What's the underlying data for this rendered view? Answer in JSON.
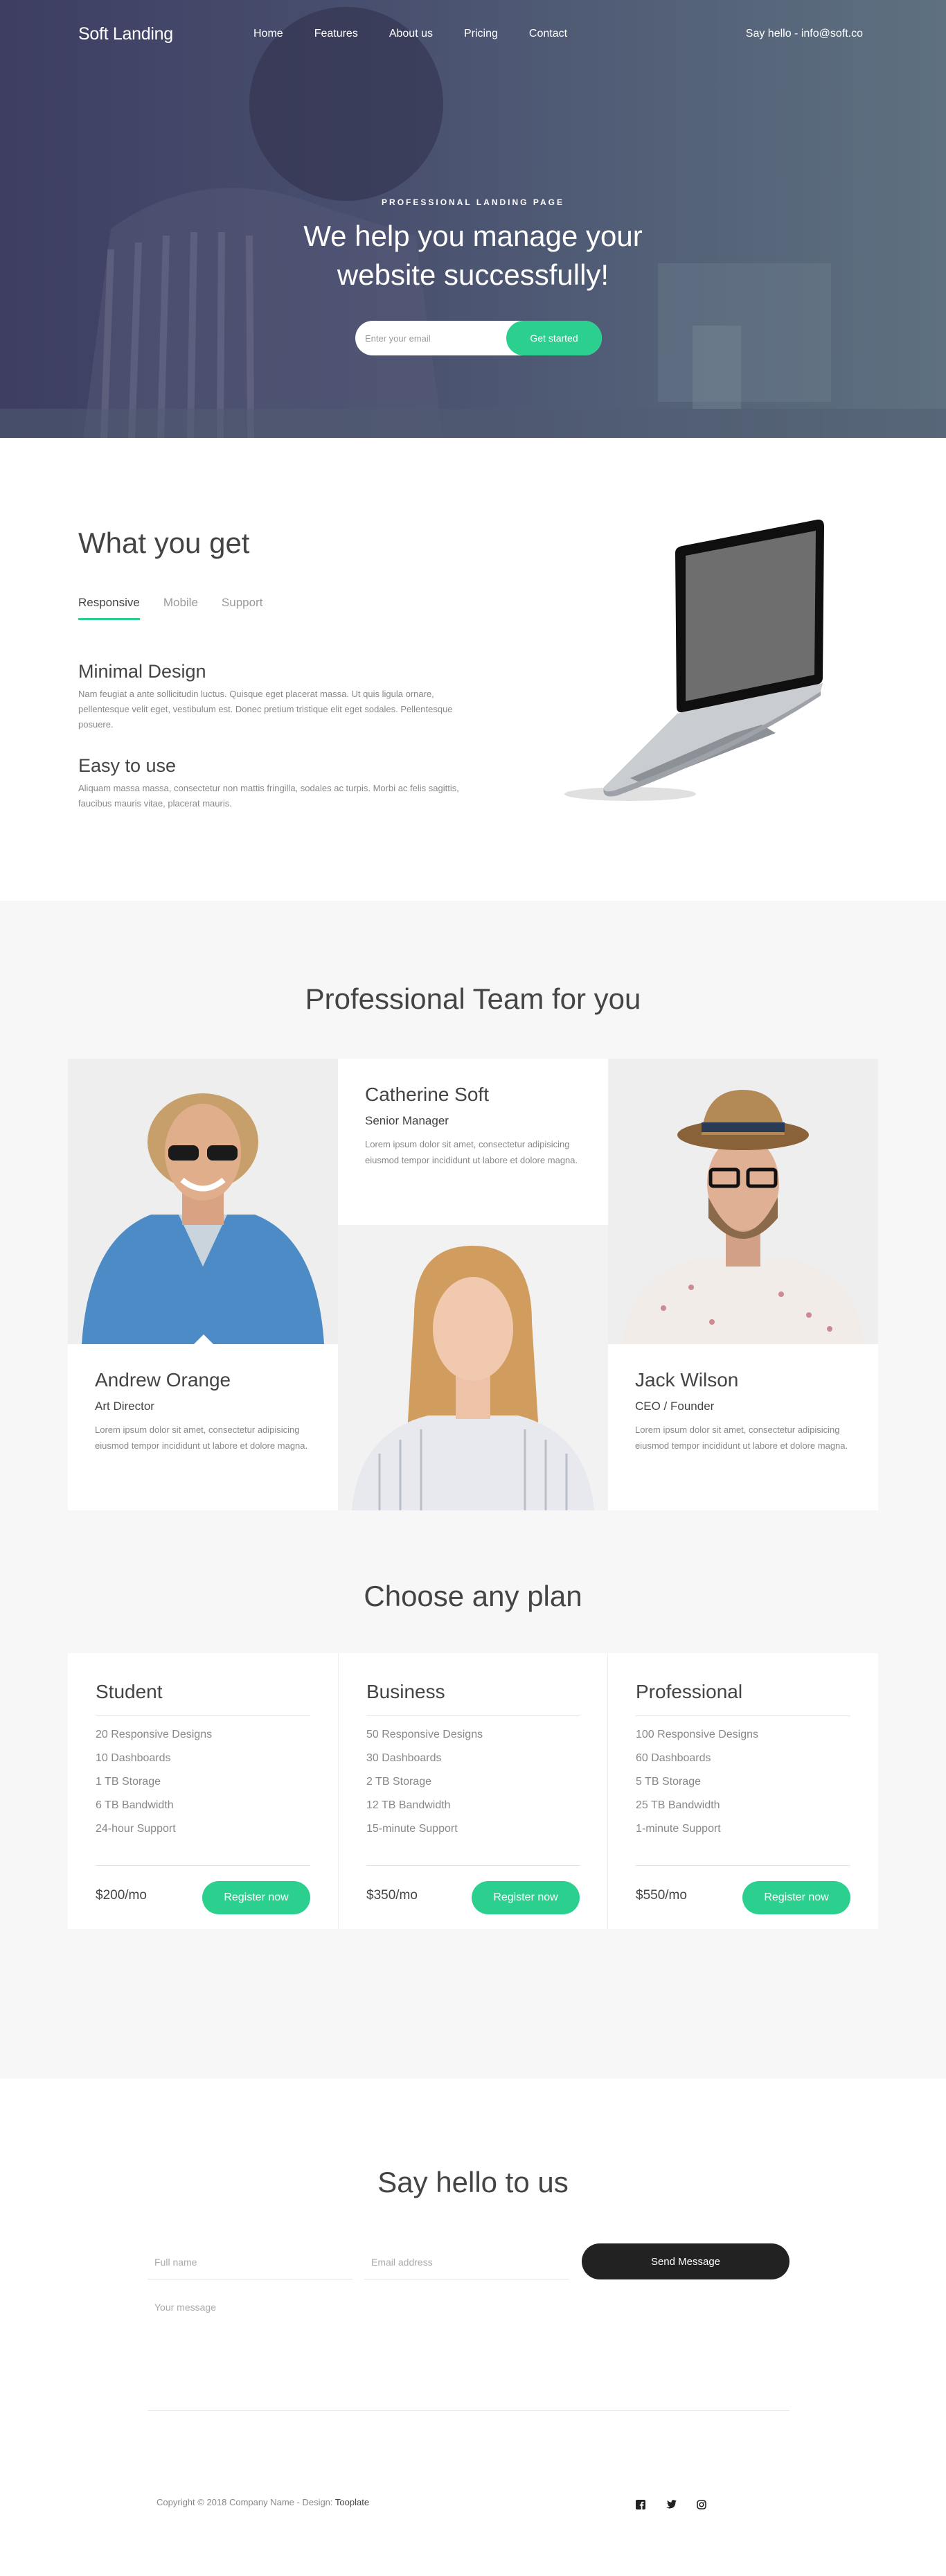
{
  "nav": {
    "brand": "Soft Landing",
    "links": [
      "Home",
      "Features",
      "About us",
      "Pricing",
      "Contact"
    ],
    "hello": "Say hello - info@soft.co"
  },
  "hero": {
    "eyebrow": "PROFESSIONAL LANDING PAGE",
    "headline_1": "We help you manage your",
    "headline_2": "website successfully!",
    "email_placeholder": "Enter your email",
    "cta": "Get started"
  },
  "features": {
    "title": "What you get",
    "tabs": [
      "Responsive",
      "Mobile",
      "Support"
    ],
    "active_tab": "Responsive",
    "items": [
      {
        "title": "Minimal Design",
        "text": "Nam feugiat a ante sollicitudin luctus. Quisque eget placerat massa. Ut quis ligula ornare, pellentesque velit eget, vestibulum est. Donec pretium tristique elit eget sodales. Pellentesque posuere."
      },
      {
        "title": "Easy to use",
        "text": "Aliquam massa massa, consectetur non mattis fringilla, sodales ac turpis. Morbi ac felis sagittis, faucibus mauris vitae, placerat mauris."
      }
    ]
  },
  "team": {
    "title": "Professional Team for you",
    "members": [
      {
        "name": "Andrew Orange",
        "role": "Art Director",
        "bio": "Lorem ipsum dolor sit amet, consectetur adipisicing eiusmod tempor incididunt ut labore et dolore magna."
      },
      {
        "name": "Catherine Soft",
        "role": "Senior Manager",
        "bio": "Lorem ipsum dolor sit amet, consectetur adipisicing eiusmod tempor incididunt ut labore et dolore magna."
      },
      {
        "name": "Jack Wilson",
        "role": "CEO / Founder",
        "bio": "Lorem ipsum dolor sit amet, consectetur adipisicing eiusmod tempor incididunt ut labore et dolore magna."
      }
    ]
  },
  "pricing": {
    "title": "Choose any plan",
    "plans": [
      {
        "name": "Student",
        "features": [
          "20 Responsive Designs",
          "10 Dashboards",
          "1 TB Storage",
          "6 TB Bandwidth",
          "24-hour Support"
        ],
        "price": "$200/mo",
        "cta": "Register now"
      },
      {
        "name": "Business",
        "features": [
          "50 Responsive Designs",
          "30 Dashboards",
          "2 TB Storage",
          "12 TB Bandwidth",
          "15-minute Support"
        ],
        "price": "$350/mo",
        "cta": "Register now"
      },
      {
        "name": "Professional",
        "features": [
          "100 Responsive Designs",
          "60 Dashboards",
          "5 TB Storage",
          "25 TB Bandwidth",
          "1-minute Support"
        ],
        "price": "$550/mo",
        "cta": "Register now"
      }
    ]
  },
  "contact": {
    "title": "Say hello to us",
    "name_placeholder": "Full name",
    "email_placeholder": "Email address",
    "message_placeholder": "Your message",
    "send": "Send Message"
  },
  "footer": {
    "copyright": "Copyright © 2018 Company Name - Design: ",
    "designer": "Tooplate",
    "social": [
      "facebook-icon",
      "twitter-icon",
      "instagram-icon"
    ]
  },
  "colors": {
    "accent": "#2bd08f",
    "dark": "#222222",
    "hero_left": "#3d3e62",
    "hero_right": "#5e7180"
  }
}
